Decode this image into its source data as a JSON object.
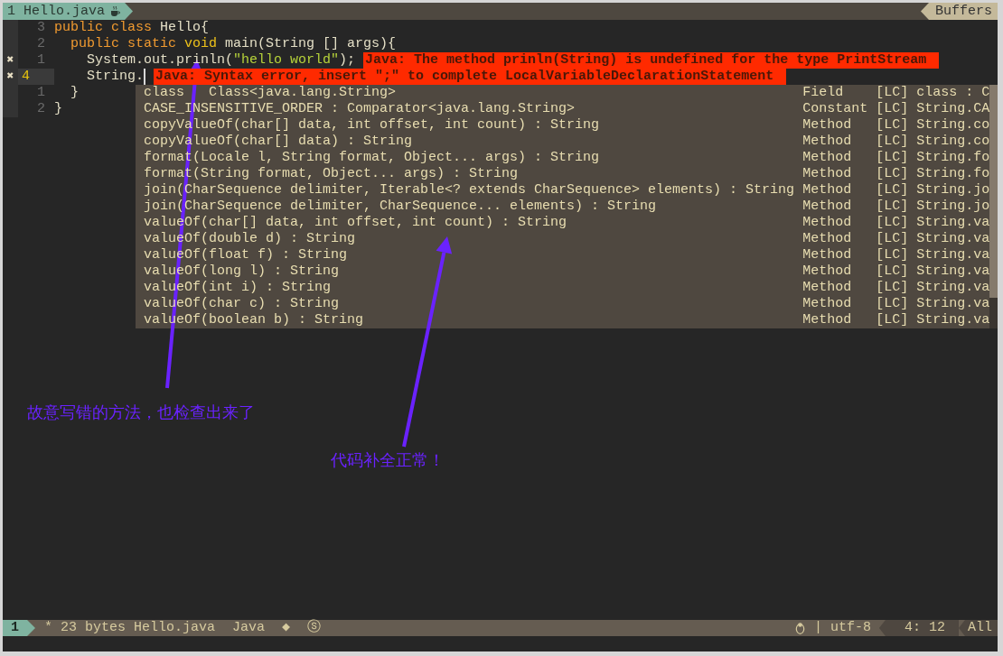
{
  "tabline": {
    "buffer_tab": "1 Hello.java",
    "right_label": "Buffers"
  },
  "code_lines": [
    {
      "number": "3",
      "current": false,
      "tokens": [
        {
          "kind": "keyword",
          "text": "public class"
        },
        {
          "kind": "plain",
          "text": " Hello{"
        }
      ]
    },
    {
      "number": "2",
      "current": false,
      "tokens": [
        {
          "kind": "keyword",
          "text": "  public static"
        },
        {
          "kind": "type",
          "text": " void"
        },
        {
          "kind": "plain",
          "text": " main(String [] args){"
        }
      ]
    },
    {
      "number": "1",
      "current": false,
      "sign": "✖",
      "tokens": [
        {
          "kind": "plain",
          "text": "    System.out.prinln("
        },
        {
          "kind": "string",
          "text": "\"hello world\""
        },
        {
          "kind": "plain",
          "text": ");"
        }
      ],
      "message": "Java: The method prinln(String) is undefined for the type PrintStream"
    },
    {
      "number": "4",
      "current": true,
      "sign": "✖",
      "tokens": [
        {
          "kind": "plain",
          "text": "    String."
        }
      ],
      "message": "Java: Syntax error, insert \";\" to complete LocalVariableDeclarationStatement"
    },
    {
      "number": "1",
      "current": false,
      "tokens": [
        {
          "kind": "plain",
          "text": "  }"
        }
      ]
    },
    {
      "number": "2",
      "current": false,
      "tokens": [
        {
          "kind": "plain",
          "text": "}"
        }
      ]
    }
  ],
  "completion": {
    "items": [
      {
        "word": "class   Class<java.lang.String>",
        "kind": "Field",
        "menu": "[LC] class : C"
      },
      {
        "word": "CASE_INSENSITIVE_ORDER : Comparator<java.lang.String>",
        "kind": "Constant",
        "menu": "[LC] String.CA"
      },
      {
        "word": "copyValueOf(char[] data, int offset, int count) : String",
        "kind": "Method",
        "menu": "[LC] String.co"
      },
      {
        "word": "copyValueOf(char[] data) : String",
        "kind": "Method",
        "menu": "[LC] String.co"
      },
      {
        "word": "format(Locale l, String format, Object... args) : String",
        "kind": "Method",
        "menu": "[LC] String.fo"
      },
      {
        "word": "format(String format, Object... args) : String",
        "kind": "Method",
        "menu": "[LC] String.fo"
      },
      {
        "word": "join(CharSequence delimiter, Iterable<? extends CharSequence> elements) : String",
        "kind": "Method",
        "menu": "[LC] String.jo"
      },
      {
        "word": "join(CharSequence delimiter, CharSequence... elements) : String",
        "kind": "Method",
        "menu": "[LC] String.jo"
      },
      {
        "word": "valueOf(char[] data, int offset, int count) : String",
        "kind": "Method",
        "menu": "[LC] String.va"
      },
      {
        "word": "valueOf(double d) : String",
        "kind": "Method",
        "menu": "[LC] String.va"
      },
      {
        "word": "valueOf(float f) : String",
        "kind": "Method",
        "menu": "[LC] String.va"
      },
      {
        "word": "valueOf(long l) : String",
        "kind": "Method",
        "menu": "[LC] String.va"
      },
      {
        "word": "valueOf(int i) : String",
        "kind": "Method",
        "menu": "[LC] String.va"
      },
      {
        "word": "valueOf(char c) : String",
        "kind": "Method",
        "menu": "[LC] String.va"
      },
      {
        "word": "valueOf(boolean b) : String",
        "kind": "Method",
        "menu": "[LC] String.va"
      }
    ]
  },
  "annotations": [
    {
      "text": "故意写错的方法，也检查出来了"
    },
    {
      "text": "代码补全正常！"
    }
  ],
  "statusline": {
    "mode": "1",
    "file": "* 23 bytes Hello.java",
    "filetype": "Java",
    "flags": [
      "◆",
      "ⓢ"
    ],
    "encoding": "| utf-8",
    "position": "4: 12",
    "percent": "All"
  }
}
